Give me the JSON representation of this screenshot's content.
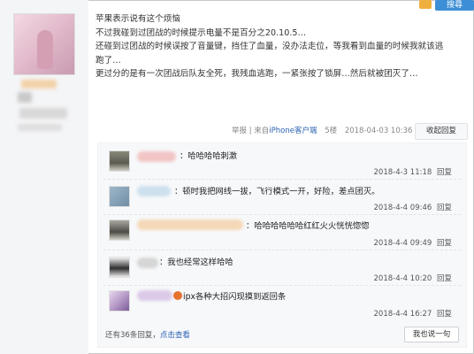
{
  "header": {
    "badge": "搜尋"
  },
  "post": {
    "lines": [
      "苹果表示说有这个烦恼",
      "不过我碰到过团战的时候提示电量不是百分之20.10.5…",
      "还碰到过团战的时候误按了音量键，挡住了血量，没办法走位，等我看到血量的时候我就该逃",
      "跑了…",
      "更过分的是有一次团战后队友全死，我残血逃跑，一紧张按了锁屏…然后就被团灭了…"
    ],
    "meta": {
      "report": "举报",
      "source_prefix": "| 来自",
      "source_link": "iPhone客户端",
      "floor": "5楼",
      "datetime": "2018-04-03 10:36",
      "collapse_label": "收起回复"
    }
  },
  "replies": [
    {
      "text": "：哈哈哈哈刺激",
      "time": "2018-4-3 11:18",
      "reply_label": "回复"
    },
    {
      "text": "：顿时我把网线一拔，飞行模式一开，好险，差点团灭。",
      "time": "2018-4-4 09:46",
      "reply_label": "回复"
    },
    {
      "text": "：哈哈哈哈哈哈红红火火恍恍惚惚",
      "time": "2018-4-4 09:49",
      "reply_label": "回复"
    },
    {
      "text": "：我也经常这样哈哈",
      "time": "2018-4-4 10:20",
      "reply_label": "回复"
    },
    {
      "text": "ipx各种大招闪现摸到返回条",
      "time": "2018-4-4 16:27",
      "reply_label": "回复"
    }
  ],
  "footer": {
    "more_prefix": "还有36条回复，",
    "more_link": "点击查看",
    "say_button": "我也说一句"
  }
}
